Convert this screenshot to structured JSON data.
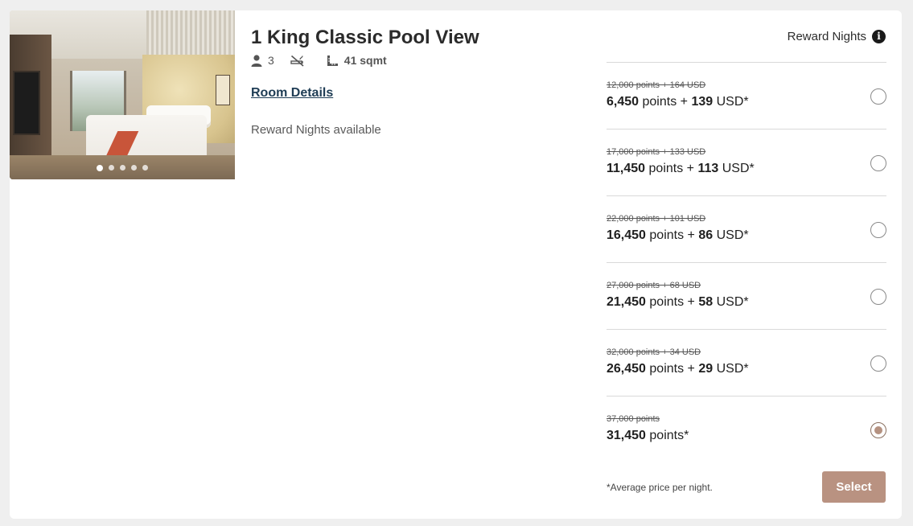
{
  "room": {
    "title": "1 King Classic Pool View",
    "guests": "3",
    "size": "41 sqmt",
    "details_link": "Room Details",
    "availability": "Reward Nights available",
    "photo_index": 1,
    "photo_count": 5
  },
  "rates_header": {
    "label": "Reward Nights",
    "icon": "info-icon"
  },
  "rates": [
    {
      "old": "12,000 points + 164 USD",
      "points": "6,450",
      "points_label": "points",
      "plus": "+",
      "usd": "139",
      "usd_label": "USD*",
      "selected": false
    },
    {
      "old": "17,000 points + 133 USD",
      "points": "11,450",
      "points_label": "points",
      "plus": "+",
      "usd": "113",
      "usd_label": "USD*",
      "selected": false
    },
    {
      "old": "22,000 points + 101 USD",
      "points": "16,450",
      "points_label": "points",
      "plus": "+",
      "usd": "86",
      "usd_label": "USD*",
      "selected": false
    },
    {
      "old": "27,000 points + 68 USD",
      "points": "21,450",
      "points_label": "points",
      "plus": "+",
      "usd": "58",
      "usd_label": "USD*",
      "selected": false
    },
    {
      "old": "32,000 points + 34 USD",
      "points": "26,450",
      "points_label": "points",
      "plus": "+",
      "usd": "29",
      "usd_label": "USD*",
      "selected": false
    },
    {
      "old": "37,000 points",
      "points": "31,450",
      "points_label": "points*",
      "plus": "",
      "usd": "",
      "usd_label": "",
      "selected": true
    }
  ],
  "footnote": "*Average price per night.",
  "select_button": "Select",
  "colors": {
    "accent": "#b99281",
    "link": "#1f3d55"
  }
}
